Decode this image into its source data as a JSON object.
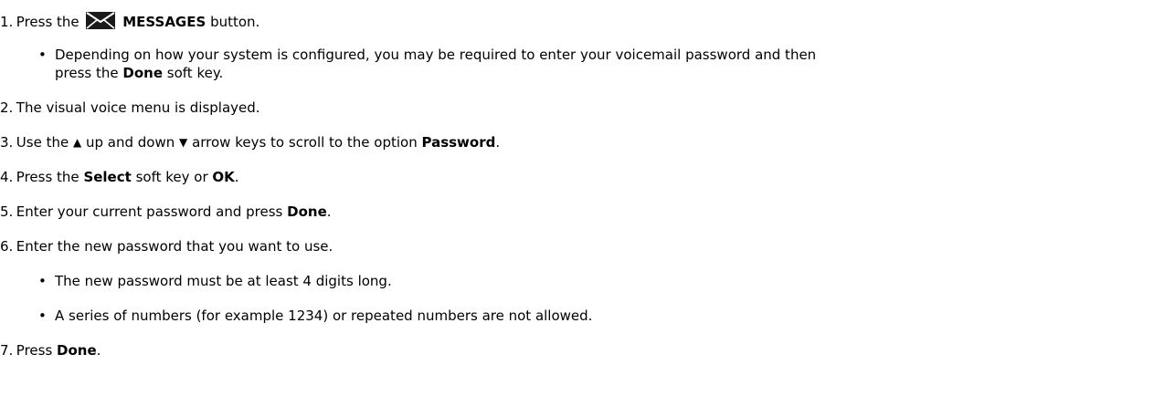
{
  "steps": {
    "s1": {
      "num": "1.",
      "pre": "Press the",
      "bold": "MESSAGES",
      "post": "button."
    },
    "s1_bullet": {
      "pre": "Depending on how your system is configured, you may be required to enter your voicemail password and then",
      "line2_pre": "press the",
      "bold": "Done",
      "post": "soft key."
    },
    "s2": {
      "num": "2.",
      "text": "The visual voice menu is displayed."
    },
    "s3": {
      "num": "3.",
      "pre": "Use the",
      "mid": "up and down",
      "post": "arrow keys to scroll to the option",
      "bold": "Password",
      "end": "."
    },
    "s4": {
      "num": "4.",
      "pre": "Press the",
      "bold1": "Select",
      "mid": "soft key or",
      "bold2": "OK",
      "end": "."
    },
    "s5": {
      "num": "5.",
      "pre": "Enter your current password and press",
      "bold": "Done",
      "end": "."
    },
    "s6": {
      "num": "6.",
      "text": "Enter the new password that you want to use."
    },
    "s6_bullets": [
      "The new password must be at least 4 digits long.",
      "A series of numbers (for example 1234) or repeated numbers are not allowed."
    ],
    "s7": {
      "num": "7.",
      "pre": "Press",
      "bold": "Done",
      "end": "."
    }
  },
  "glyphs": {
    "bullet": "•",
    "up_arrow": "▲",
    "down_arrow": "▼"
  },
  "icons": {
    "messages": "envelope-icon"
  },
  "colors": {
    "text": "#000000",
    "icon_fill": "#1a1a1a",
    "background": "#ffffff"
  }
}
